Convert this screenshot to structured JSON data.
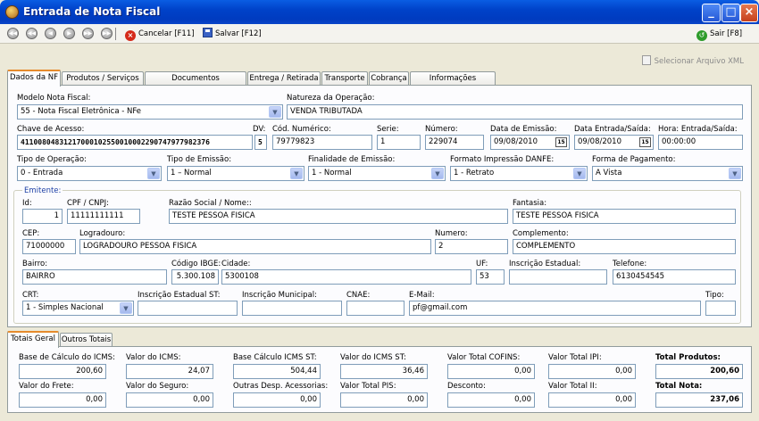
{
  "window": {
    "title": "Entrada de Nota Fiscal"
  },
  "toolbar": {
    "cancel_label": "Cancelar [F11]",
    "save_label": "Salvar [F12]",
    "exit_label": "Sair [F8]"
  },
  "select_file": "Selecionar Arquivo XML",
  "tabs": [
    "Dados da NF",
    "Produtos / Serviços",
    "Documentos Referenciados",
    "Entrega / Retirada",
    "Transporte",
    "Cobrança",
    "Informações Adicionais"
  ],
  "nf": {
    "modelo": {
      "label": "Modelo Nota Fiscal:",
      "value": "55 - Nota Fiscal Eletrônica - NFe"
    },
    "natureza": {
      "label": "Natureza da Operação:",
      "value": "VENDA TRIBUTADA"
    },
    "chave": {
      "label": "Chave de Acesso:",
      "value": "41100804831217000102550010002290747977982376"
    },
    "dv": {
      "label": "DV:",
      "value": "5"
    },
    "cod_numerico": {
      "label": "Cód. Numérico:",
      "value": "79779823"
    },
    "serie": {
      "label": "Serie:",
      "value": "1"
    },
    "numero": {
      "label": "Número:",
      "value": "229074"
    },
    "data_emissao": {
      "label": "Data de Emissão:",
      "value": "09/08/2010"
    },
    "data_entrada": {
      "label": "Data Entrada/Saída:",
      "value": "09/08/2010"
    },
    "hora": {
      "label": "Hora: Entrada/Saída:",
      "value": "00:00:00"
    },
    "tipo_operacao": {
      "label": "Tipo de Operação:",
      "value": "0 - Entrada"
    },
    "tipo_emissao": {
      "label": "Tipo de Emissão:",
      "value": "1 – Normal"
    },
    "finalidade": {
      "label": "Finalidade de Emissão:",
      "value": "1 - Normal"
    },
    "formato": {
      "label": "Formato Impressão DANFE:",
      "value": "1 - Retrato"
    },
    "pagamento": {
      "label": "Forma de Pagamento:",
      "value": "A Vista"
    }
  },
  "emitente": {
    "title": "Emitente:",
    "id": {
      "label": "Id:",
      "value": "1"
    },
    "cpf": {
      "label": "CPF / CNPJ:",
      "value": "11111111111"
    },
    "razao": {
      "label": "Razão Social / Nome::",
      "value": "TESTE PESSOA FISICA"
    },
    "fantasia": {
      "label": "Fantasia:",
      "value": "TESTE PESSOA FISICA"
    },
    "cep": {
      "label": "CEP:",
      "value": "71000000"
    },
    "logradouro": {
      "label": "Logradouro:",
      "value": "LOGRADOURO PESSOA FISICA"
    },
    "numero": {
      "label": "Numero:",
      "value": "2"
    },
    "complemento": {
      "label": "Complemento:",
      "value": "COMPLEMENTO"
    },
    "bairro": {
      "label": "Bairro:",
      "value": "BAIRRO"
    },
    "ibge": {
      "label": "Código IBGE:",
      "value": "5.300.108"
    },
    "cidade": {
      "label": "Cidade:",
      "value": "5300108"
    },
    "uf": {
      "label": "UF:",
      "value": "53"
    },
    "ie": {
      "label": "Inscrição Estadual:",
      "value": ""
    },
    "telefone": {
      "label": "Telefone:",
      "value": "6130454545"
    },
    "crt": {
      "label": "CRT:",
      "value": "1 - Simples Nacional"
    },
    "ie_st": {
      "label": "Inscrição Estadual ST:",
      "value": ""
    },
    "im": {
      "label": "Inscrição Municipal:",
      "value": ""
    },
    "cnae": {
      "label": "CNAE:",
      "value": ""
    },
    "email": {
      "label": "E-Mail:",
      "value": "pf@gmail.com"
    },
    "tipo": {
      "label": "Tipo:",
      "value": ""
    }
  },
  "bottom_tabs": [
    "Totais Geral",
    "Outros Totais"
  ],
  "totais": {
    "bc_icms": {
      "label": "Base de Cálculo do ICMS:",
      "value": "200,60"
    },
    "v_icms": {
      "label": "Valor do ICMS:",
      "value": "24,07"
    },
    "bc_st": {
      "label": "Base Cálculo ICMS ST:",
      "value": "504,44"
    },
    "v_st": {
      "label": "Valor do ICMS ST:",
      "value": "36,46"
    },
    "cofins": {
      "label": "Valor Total COFINS:",
      "value": "0,00"
    },
    "ipi": {
      "label": "Valor Total IPI:",
      "value": "0,00"
    },
    "produtos": {
      "label": "Total Produtos:",
      "value": "200,60"
    },
    "frete": {
      "label": "Valor do Frete:",
      "value": "0,00"
    },
    "seguro": {
      "label": "Valor do Seguro:",
      "value": "0,00"
    },
    "outras": {
      "label": "Outras Desp. Acessorias:",
      "value": "0,00"
    },
    "pis": {
      "label": "Valor Total PIS:",
      "value": "0,00"
    },
    "desconto": {
      "label": "Desconto:",
      "value": "0,00"
    },
    "ii": {
      "label": "Valor Total II:",
      "value": "0,00"
    },
    "nota": {
      "label": "Total Nota:",
      "value": "237,06"
    }
  }
}
